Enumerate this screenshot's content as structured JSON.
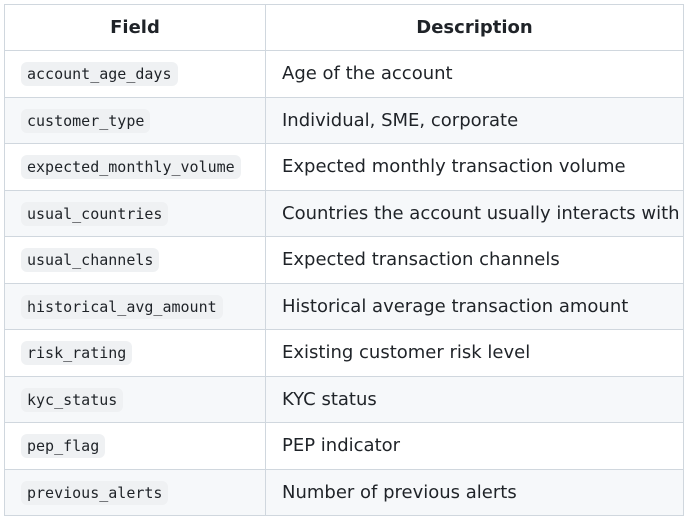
{
  "table": {
    "headers": {
      "field": "Field",
      "description": "Description"
    },
    "rows": [
      {
        "field": "account_age_days",
        "description": "Age of the account"
      },
      {
        "field": "customer_type",
        "description": "Individual, SME, corporate"
      },
      {
        "field": "expected_monthly_volume",
        "description": "Expected monthly transaction volume"
      },
      {
        "field": "usual_countries",
        "description": "Countries the account usually interacts with"
      },
      {
        "field": "usual_channels",
        "description": "Expected transaction channels"
      },
      {
        "field": "historical_avg_amount",
        "description": "Historical average transaction amount"
      },
      {
        "field": "risk_rating",
        "description": "Existing customer risk level"
      },
      {
        "field": "kyc_status",
        "description": "KYC status"
      },
      {
        "field": "pep_flag",
        "description": "PEP indicator"
      },
      {
        "field": "previous_alerts",
        "description": "Number of previous alerts"
      }
    ]
  }
}
